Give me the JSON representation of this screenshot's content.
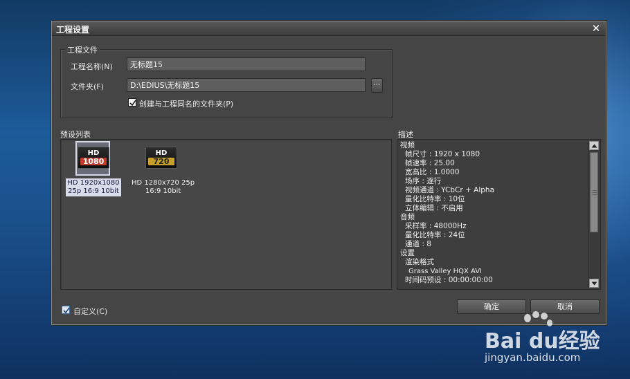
{
  "dialog": {
    "title": "工程设置"
  },
  "project_file": {
    "group_label": "工程文件",
    "name_label": "工程名称(N)",
    "name_value": "无标题15",
    "folder_label": "文件夹(F)",
    "folder_value": "D:\\EDIUS\\无标题15",
    "browse_label": "...",
    "create_folder_label": "创建与工程同名的文件夹(P)",
    "create_folder_checked": true
  },
  "presets": {
    "section_label": "预设列表",
    "items": [
      {
        "icon_top": "HD",
        "icon_res": "1080",
        "caption_line1": "HD 1920x1080",
        "caption_line2": "25p 16:9 10bit",
        "selected": true
      },
      {
        "icon_top": "HD",
        "icon_res": "720",
        "caption_line1": "HD 1280x720 25p",
        "caption_line2": "16:9 10bit",
        "selected": false
      }
    ]
  },
  "description": {
    "section_label": "描述",
    "lines": [
      "视频",
      "帧尺寸 : 1920 x 1080",
      "帧速率 : 25.00",
      "宽高比 : 1.0000",
      "场序 : 逐行",
      "视频通道 : YCbCr + Alpha",
      "量化比特率 :  10位",
      "立体编辑 : 不启用",
      "音频",
      "采样率 : 48000Hz",
      "量化比特率 : 24位",
      "通道 : 8",
      "设置",
      "渲染格式",
      "Grass Valley HQX AVI",
      "时间码预设 : 00:00:00:00"
    ]
  },
  "footer": {
    "custom_label": "自定义(C)",
    "custom_checked": true,
    "ok_label": "确定",
    "cancel_label": "取消"
  },
  "watermark": {
    "brand": "Bai du经验",
    "url": "jingyan.baidu.com"
  },
  "colors": {
    "dialog_bg": "#454545",
    "field_bg": "#5e5e5e",
    "hd1080_accent": "#c23a2a",
    "hd720_accent": "#c6a028"
  }
}
